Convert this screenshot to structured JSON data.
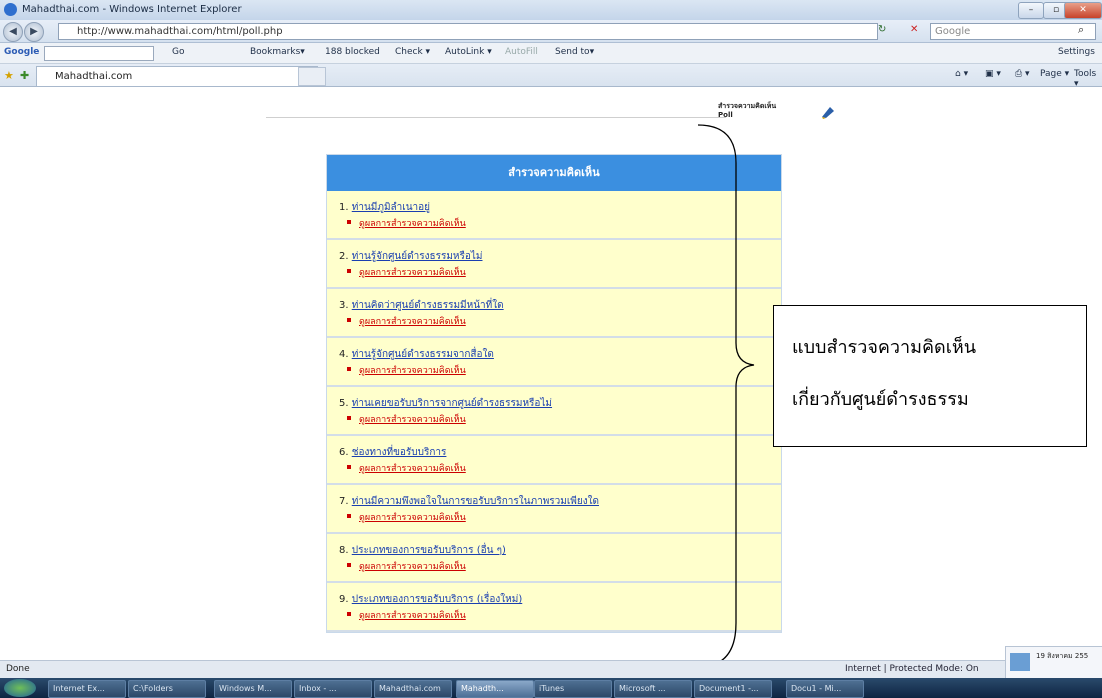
{
  "window": {
    "title": "Mahadthai.com - Windows Internet Explorer"
  },
  "address_bar": {
    "url": "http://www.mahadthai.com/html/poll.php",
    "search_placeholder": "Google"
  },
  "google_toolbar": {
    "brand": "Google",
    "go_label": "Go",
    "bookmarks_label": "Bookmarks▾",
    "blocked_label": "188 blocked",
    "check_label": "Check ▾",
    "autolink_label": "AutoLink ▾",
    "autofill_label": "AutoFill",
    "sendto_label": "Send to▾",
    "settings_label": "Settings"
  },
  "tab_bar": {
    "active_tab": "Mahadthai.com",
    "tools": [
      "Page ▾",
      "Tools ▾"
    ]
  },
  "content": {
    "poll_heading_thai": "สำรวจความคิดเห็น",
    "poll_heading_en": "Poll",
    "panel_title": "สำรวจความคิดเห็น",
    "results_link": "ดูผลการสำรวจความคิดเห็น",
    "questions": [
      {
        "num": "1.",
        "text": "ท่านมีภูมิลำเนาอยู่"
      },
      {
        "num": "2.",
        "text": "ท่านรู้จักศูนย์ดำรงธรรมหรือไม่"
      },
      {
        "num": "3.",
        "text": "ท่านคิดว่าศูนย์ดำรงธรรมมีหน้าที่ใด"
      },
      {
        "num": "4.",
        "text": "ท่านรู้จักศูนย์ดำรงธรรมจากสื่อใด"
      },
      {
        "num": "5.",
        "text": "ท่านเคยขอรับบริการจากศูนย์ดำรงธรรมหรือไม่"
      },
      {
        "num": "6.",
        "text": "ช่องทางที่ขอรับบริการ"
      },
      {
        "num": "7.",
        "text": "ท่านมีความพึงพอใจในการขอรับบริการในภาพรวมเพียงใด"
      },
      {
        "num": "8.",
        "text": "ประเภทของการขอรับบริการ (อื่น ๆ)"
      },
      {
        "num": "9.",
        "text": "ประเภทของการขอรับบริการ (เรื่องใหม่)"
      }
    ],
    "callout_line1": "แบบสำรวจความคิดเห็น",
    "callout_line2": "เกี่ยวกับศูนย์ดำรงธรรม"
  },
  "status_bar": {
    "left": "Done",
    "zone": "Internet | Protected Mode: On"
  },
  "notification": {
    "text": "19 สิงหาคม 255"
  },
  "taskbar": {
    "items": [
      "Internet Ex...",
      "C:\\Folders",
      "Windows M...",
      "Inbox - ...",
      "Mahadthai.com",
      "Mahadth...",
      "iTunes",
      "Microsoft ...",
      "Document1 -...",
      "Docu1 - Mi..."
    ],
    "active_index": 5
  }
}
